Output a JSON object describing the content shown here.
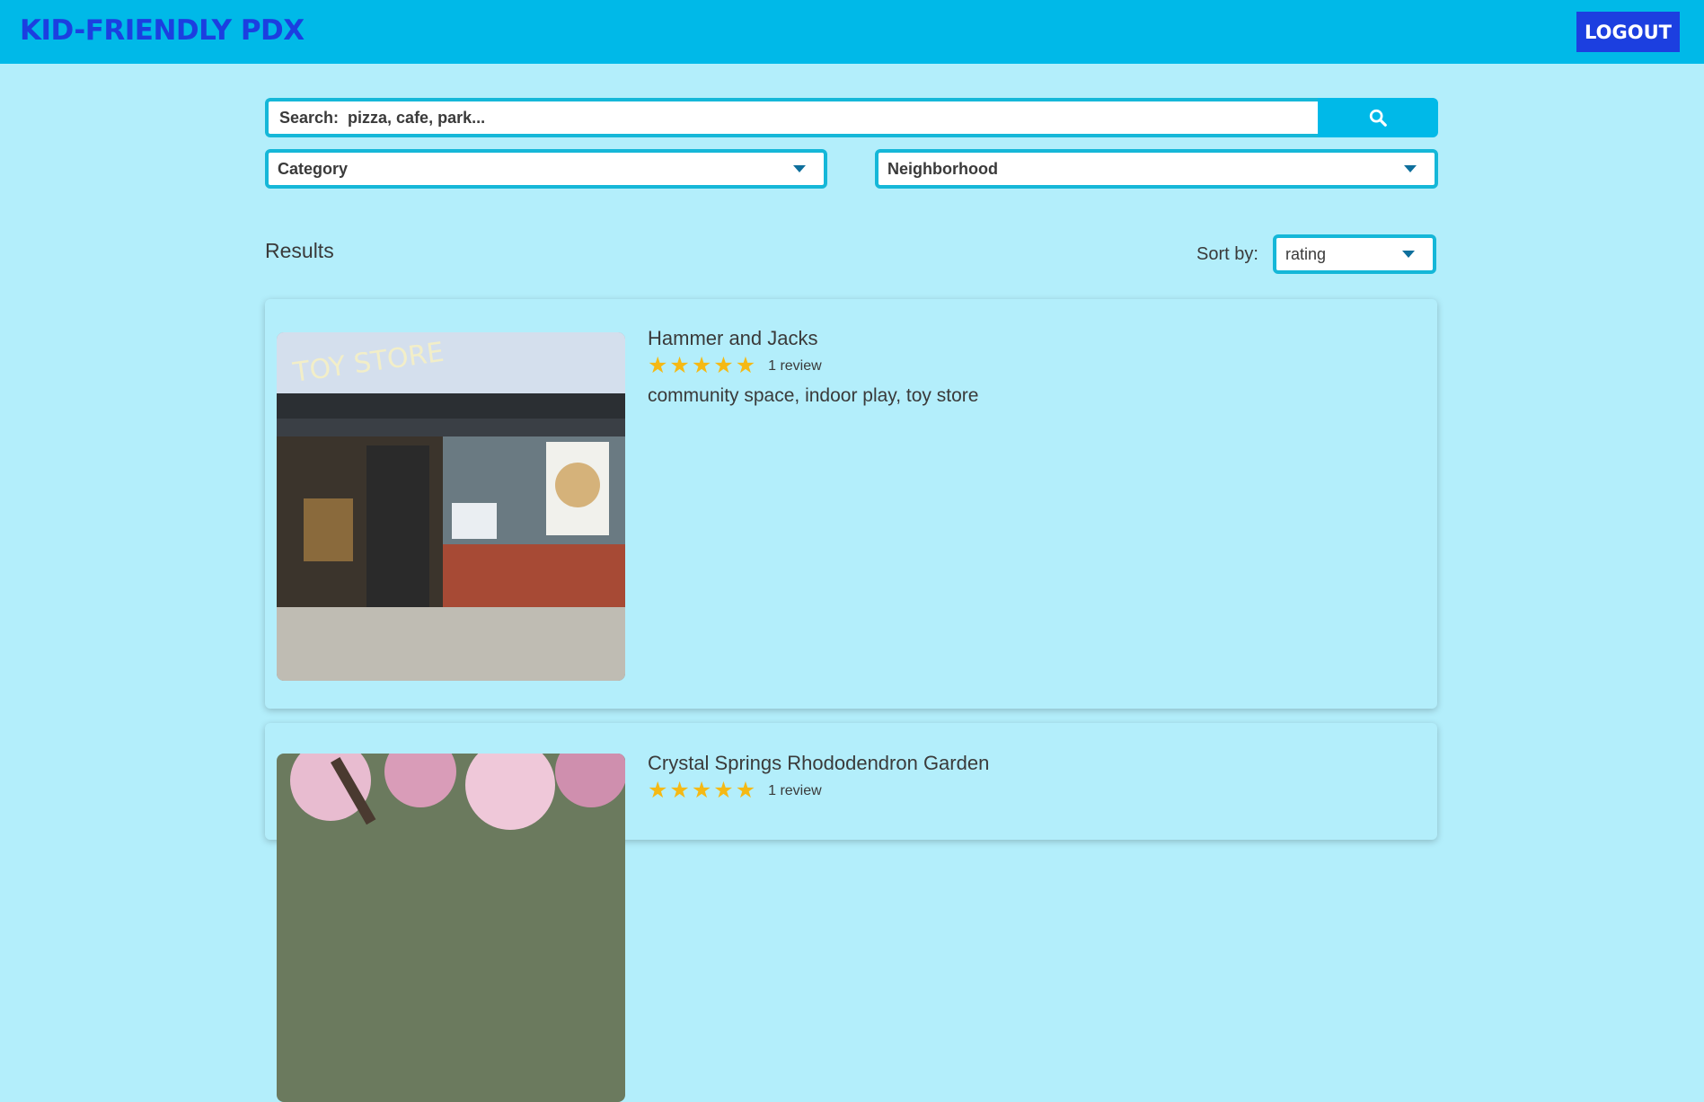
{
  "header": {
    "brand": "KID-FRIENDLY PDX",
    "logout_label": "LOGOUT",
    "bg_color": "#00b9e8",
    "accent_color": "#1c3fe0"
  },
  "search": {
    "placeholder": "Search:  pizza, cafe, park...",
    "button_icon": "search-icon"
  },
  "filters": {
    "category": "Category",
    "neighborhood": "Neighborhood"
  },
  "results": {
    "title": "Results",
    "sort_label": "Sort by:",
    "sort_value": "rating"
  },
  "cards": [
    {
      "name": "Hammer and Jacks",
      "rating": 5,
      "reviews": "1 review",
      "tags": "community space, indoor play, toy store"
    },
    {
      "name": "Crystal Springs Rhododendron Garden",
      "rating": 5,
      "reviews": "1 review",
      "tags": ""
    }
  ]
}
